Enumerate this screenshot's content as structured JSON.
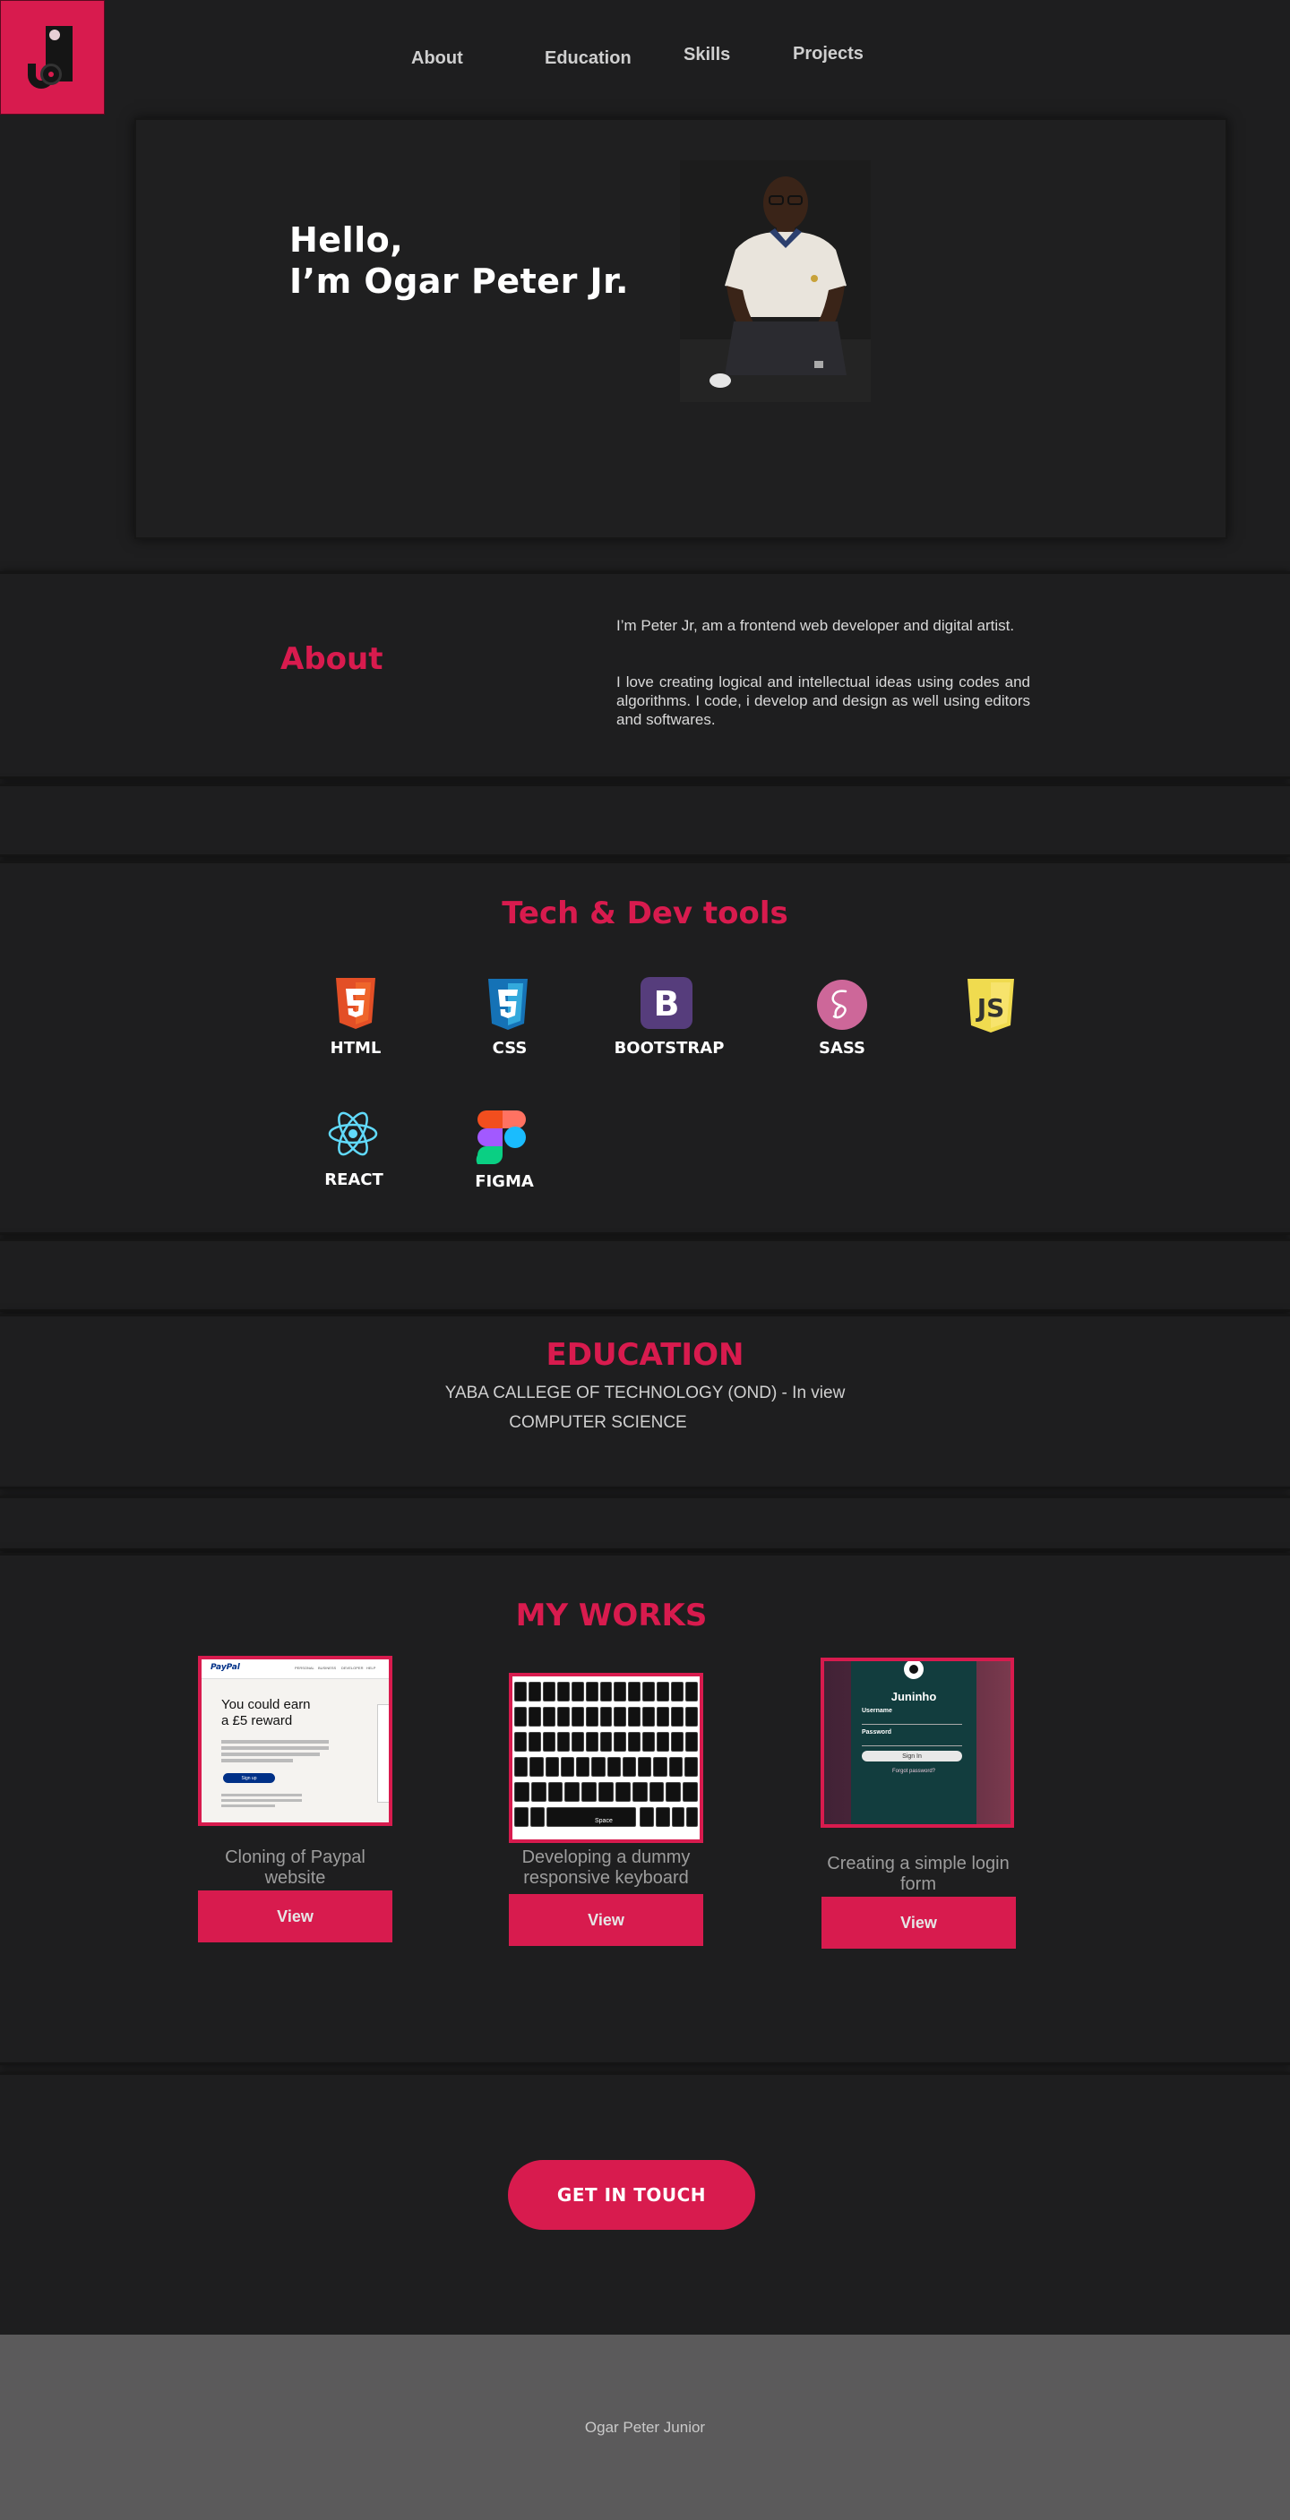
{
  "nav": {
    "links": [
      "About",
      "Education",
      "Skills",
      "Projects"
    ]
  },
  "hero": {
    "line1": "Hello,",
    "line2": "I’m Ogar Peter Jr."
  },
  "about": {
    "title": "About",
    "paragraph1": "I’m Peter Jr, am a frontend web developer and digital artist.",
    "paragraph2": "I love creating logical and intellectual ideas using codes and algorithms. I code, i develop and design as well using editors and softwares."
  },
  "tools": {
    "title": "Tech & Dev tools",
    "items": [
      "HTML",
      "CSS",
      "BOOTSTRAP",
      "SASS",
      "REACT",
      "FIGMA"
    ]
  },
  "education": {
    "title": "EDUCATION",
    "school": "YABA CALLEGE OF TECHNOLOGY (OND)  - In view",
    "course": "COMPUTER SCIENCE"
  },
  "works": {
    "title": "MY WORKS",
    "items": [
      {
        "caption": "Cloning of Paypal website",
        "button": "View",
        "thumb": {
          "brand": "PayPal",
          "menu": [
            "PERSONAL",
            "BUSINESS",
            "DEVELOPER",
            "HELP"
          ],
          "headline": "You could earn a £5 reward",
          "signup": "Sign up"
        }
      },
      {
        "caption": "Developing  a dummy responsive keyboard",
        "button": "View",
        "thumb": {
          "space": "Space"
        }
      },
      {
        "caption": "Creating a simple login form",
        "button": "View",
        "thumb": {
          "brand": "Juninho",
          "username_label": "Username",
          "password_label": "Password",
          "signin": "Sign In",
          "forgot": "Forgot password?"
        }
      }
    ]
  },
  "contact": {
    "button": "GET IN TOUCH"
  },
  "footer": {
    "text": "Ogar Peter Junior"
  },
  "colors": {
    "accent": "#d81b4e",
    "background": "#1e1e1f",
    "footer": "#5b5a5b"
  }
}
